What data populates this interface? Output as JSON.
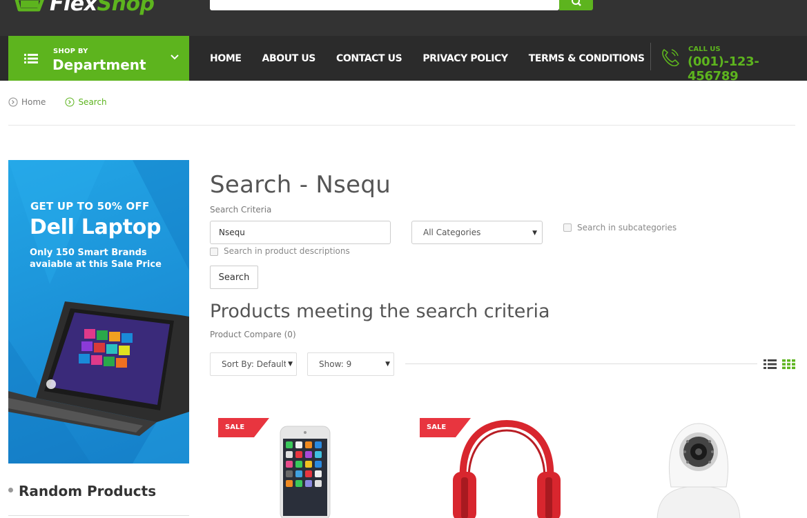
{
  "header": {
    "logo_text_1": "Flex",
    "logo_text_2": "Shop"
  },
  "nav": {
    "department_small": "SHOP BY",
    "department_big": "Department",
    "links": [
      "HOME",
      "ABOUT US",
      "CONTACT US",
      "PRIVACY POLICY",
      "TERMS & CONDITIONS"
    ],
    "call_label": "CALL US",
    "call_number": "(001)-123-456789"
  },
  "breadcrumb": {
    "items": [
      "Home",
      "Search"
    ]
  },
  "sidebar": {
    "banner": {
      "line1": "GET UP TO 50% OFF",
      "line2": "Dell Laptop",
      "line3": "Only 150 Smart Brands avaiable at this Sale Price"
    },
    "random_products_title": "Random Products"
  },
  "main": {
    "title": "Search - Nsequ",
    "criteria_label": "Search Criteria",
    "search_value": "Nsequ",
    "category_selected": "All Categories",
    "subcategories_label": "Search in subcategories",
    "descriptions_label": "Search in product descriptions",
    "search_button": "Search",
    "products_title": "Products meeting the search criteria",
    "compare_link": "Product Compare (0)",
    "sort_selected": "Sort By: Default",
    "show_selected": "Show: 9"
  },
  "products": [
    {
      "badge": "SALE",
      "image": "smartphone"
    },
    {
      "badge": "SALE",
      "image": "red-headphones"
    },
    {
      "badge": "",
      "image": "security-camera"
    }
  ],
  "colors": {
    "accent": "#5db41e",
    "topbar": "#333333",
    "navbar": "#2b2b2b",
    "sale": "#e8353f",
    "banner_blue": "#1b8fd6"
  }
}
